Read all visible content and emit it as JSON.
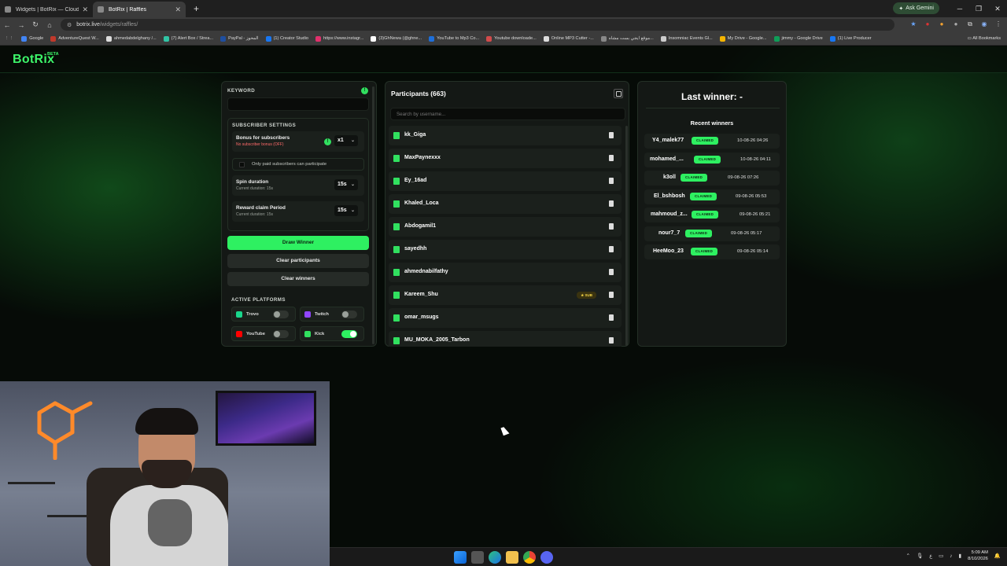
{
  "browser": {
    "tabs": [
      {
        "title": "Widgets | BotRix — Cloud Strea"
      },
      {
        "title": "BotRix | Raffles"
      }
    ],
    "new_tab": "+",
    "ask_gemini": "Ask Gemini",
    "url_host": "botrix.live",
    "url_path": "/widgets/raffles/",
    "bookmarks": [
      {
        "label": "Google",
        "color": "#4285f4"
      },
      {
        "label": "AdventureQuest W...",
        "color": "#c0392b"
      },
      {
        "label": "ahmedabdelghany /...",
        "color": "#dddddd"
      },
      {
        "label": "(7) Alert Box / Strea...",
        "color": "#31c4a5"
      },
      {
        "label": "PayPal - المحوز",
        "color": "#1f4fa0"
      },
      {
        "label": "(1) Creator Studio",
        "color": "#1877f2"
      },
      {
        "label": "https://www.instagr...",
        "color": "#e1306c"
      },
      {
        "label": "(3)GhNewa (@ghne...",
        "color": "#ffffff"
      },
      {
        "label": "YouTube to Mp3 Co...",
        "color": "#1e6fd9"
      },
      {
        "label": "Youtube downloade...",
        "color": "#d24b4b"
      },
      {
        "label": "Online MP3 Cutter -...",
        "color": "#dddddd"
      },
      {
        "label": "موقع ايجي بست مشاه...",
        "color": "#888888"
      },
      {
        "label": "Insomniac Events Gl...",
        "color": "#cccccc"
      },
      {
        "label": "My Drive - Google...",
        "color": "#f4b400"
      },
      {
        "label": "jimmy - Google Drive",
        "color": "#0f9d58"
      },
      {
        "label": "(1) Live Producer",
        "color": "#1877f2"
      }
    ],
    "all_bookmarks": "All Bookmarks"
  },
  "site": {
    "logo": "BotRix",
    "beta": "BETA"
  },
  "settings": {
    "keyword_label": "KEYWORD",
    "keyword_value": "",
    "subscriber_settings_label": "SUBSCRIBER SETTINGS",
    "bonus_label": "Bonus for subscribers",
    "bonus_sub": "No subscriber bonus (OFF)",
    "bonus_value": "x1",
    "only_paid_label": "Only paid subscribers can participate",
    "spin_label": "Spin duration",
    "spin_sub": "Current duration: 15s",
    "spin_value": "15s",
    "reward_label": "Reward claim Period",
    "reward_sub": "Current duration: 15s",
    "reward_value": "15s",
    "draw_winner": "Draw Winner",
    "clear_participants": "Clear participants",
    "clear_winners": "Clear winners",
    "active_platforms_label": "ACTIVE PLATFORMS",
    "platforms": [
      {
        "name": "Trovo",
        "enabled": false,
        "color": "#19d68c"
      },
      {
        "name": "Twitch",
        "enabled": false,
        "color": "#9146ff"
      },
      {
        "name": "YouTube",
        "enabled": false,
        "color": "#ff0000"
      },
      {
        "name": "Kick",
        "enabled": true,
        "color": "#31e05f"
      }
    ]
  },
  "participants": {
    "title": "Participants (663)",
    "search_placeholder": "Search by username...",
    "list": [
      {
        "name": "kk_Giga",
        "sub": false
      },
      {
        "name": "MaxPaynexxx",
        "sub": false
      },
      {
        "name": "Ey_16ad",
        "sub": false
      },
      {
        "name": "Khaled_Loca",
        "sub": false
      },
      {
        "name": "Abdogamil1",
        "sub": false
      },
      {
        "name": "sayedhh",
        "sub": false
      },
      {
        "name": "ahmednabilfathy",
        "sub": false
      },
      {
        "name": "Kareem_Shu",
        "sub": true
      },
      {
        "name": "omar_msugs",
        "sub": false
      },
      {
        "name": "MU_MOKA_2005_Tarbon",
        "sub": false
      }
    ],
    "sub_badge": "★ SUB"
  },
  "winners": {
    "last_winner": "Last winner: -",
    "recent_title": "Recent winners",
    "claimed_label": "CLAIMED",
    "list": [
      {
        "name": "Y4_malek77",
        "date": "10-08-26 04:26"
      },
      {
        "name": "mohamed_...",
        "date": "10-08-26 04:11"
      },
      {
        "name": "k3oll",
        "date": "09-08-26 07:26"
      },
      {
        "name": "El_bshbosh",
        "date": "09-08-26 05:53"
      },
      {
        "name": "mahmoud_z...",
        "date": "09-08-26 05:21"
      },
      {
        "name": "nour7_7",
        "date": "09-08-26 05:17"
      },
      {
        "name": "HeeMoo_23",
        "date": "09-08-26 05:14"
      }
    ]
  },
  "taskbar": {
    "time": "5:09 AM",
    "date": "8/10/2026"
  }
}
